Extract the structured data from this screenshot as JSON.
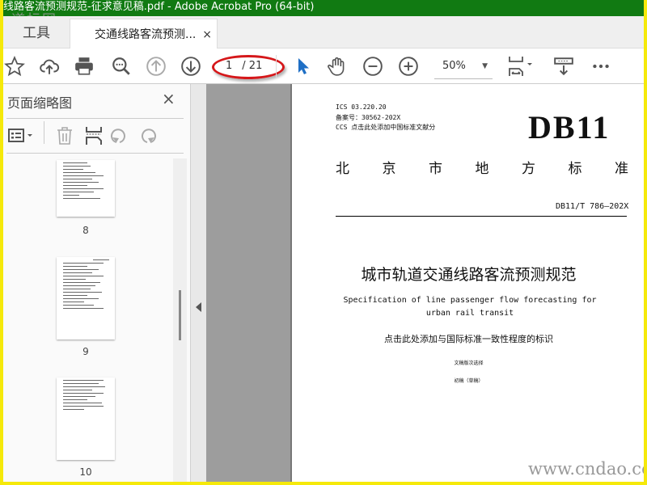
{
  "window": {
    "title": "线路客流预测规范-征求意见稿.pdf - Adobe Acrobat Pro (64-bit)",
    "watermark_logo": "道标网"
  },
  "tabs": {
    "tools": "工具",
    "document": "交通线路客流预测...",
    "close": "×"
  },
  "toolbar": {
    "current_page": "1",
    "total_pages": "/ 21",
    "zoom": "50%"
  },
  "panel": {
    "title": "页面缩略图",
    "close": "×",
    "thumbnails": [
      {
        "label": "8"
      },
      {
        "label": "9"
      },
      {
        "label": "10"
      }
    ]
  },
  "document": {
    "ics": "ICS  03.220.20",
    "record": "备案号：30562-202X",
    "ccs": "CCS  点击此处添加中国标准文献分",
    "logo": "DB11",
    "authority": [
      "北",
      "京",
      "市",
      "地",
      "方",
      "标",
      "准"
    ],
    "number": "DB11/T 786—202X",
    "title_cn": "城市轨道交通线路客流预测规范",
    "title_en": "Specification of line passenger flow forecasting for urban rail transit",
    "consistency": "点击此处添加与国际标准一致性程度的标识",
    "version_label": "文稿版次选择",
    "draft": "初稿（草稿）"
  },
  "site_watermark": "www.cndao.com"
}
